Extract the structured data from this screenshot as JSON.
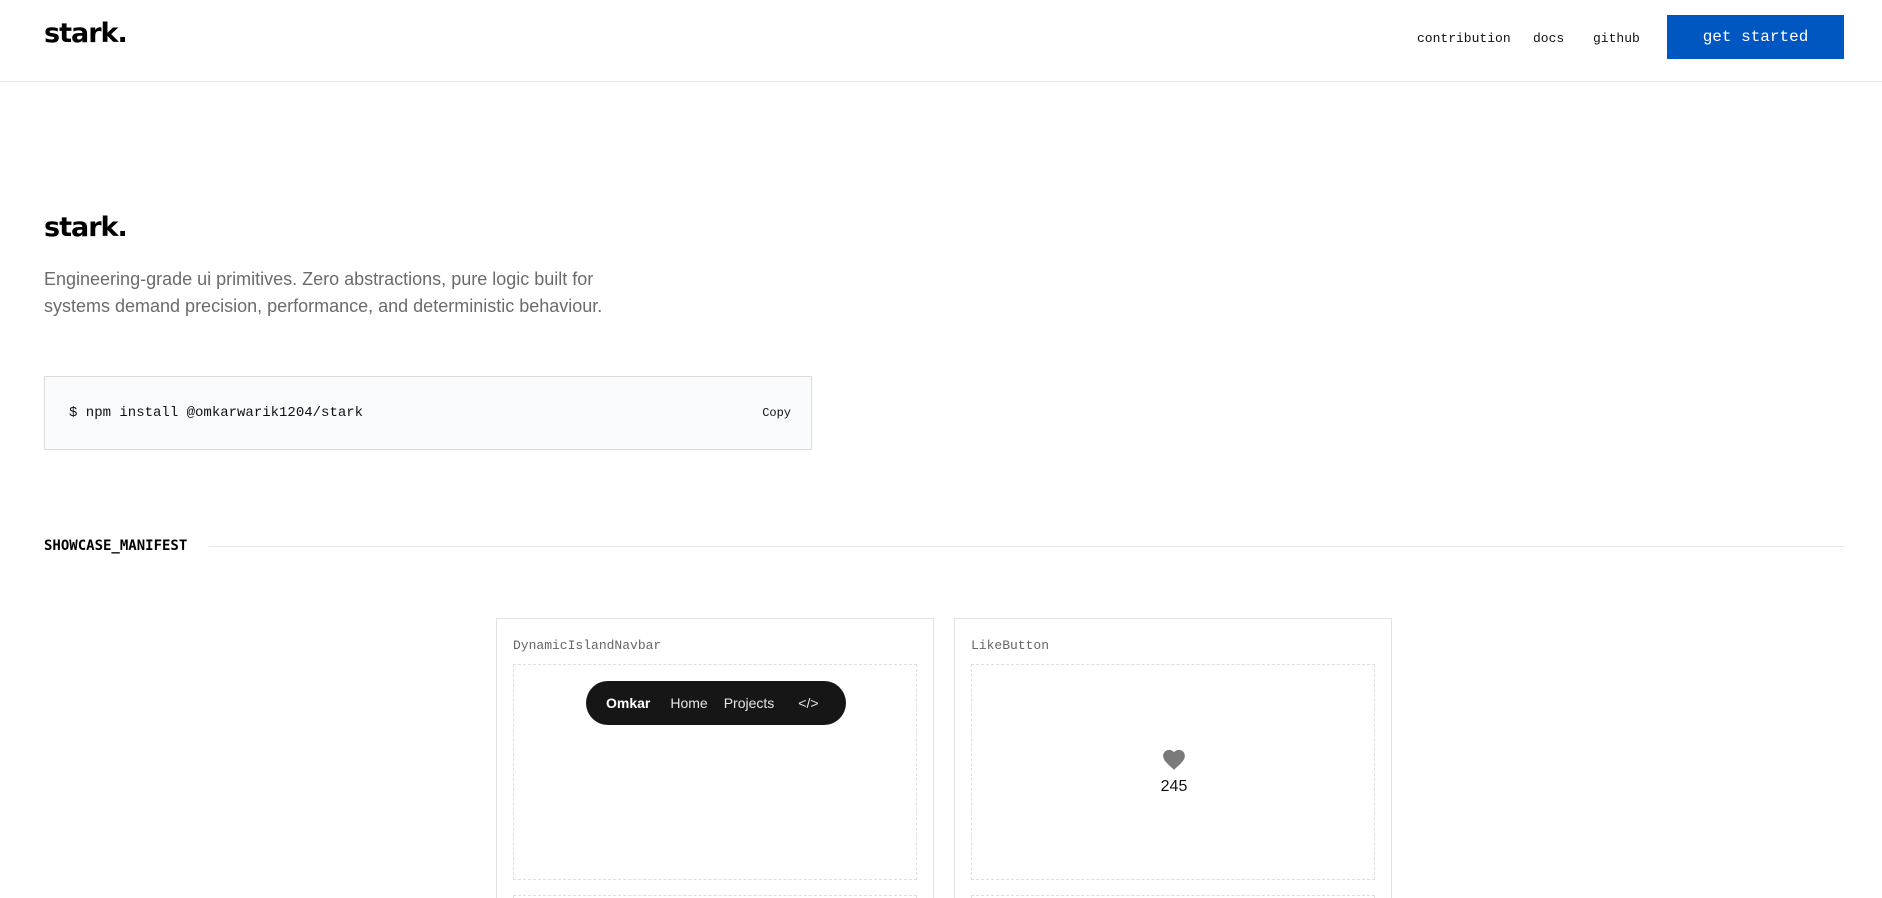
{
  "header": {
    "logo": "stark.",
    "nav": {
      "contribution": "contribution",
      "docs": "docs",
      "github": "github"
    },
    "cta_label": "get started",
    "accent_color": "#0057c2"
  },
  "hero": {
    "title": "stark.",
    "description": "Engineering-grade ui primitives. Zero abstractions, pure logic built for systems demand precision, performance, and deterministic behaviour."
  },
  "install": {
    "command": "$ npm install @omkarwarik1204/stark",
    "copy_label": "Copy"
  },
  "showcase": {
    "label": "SHOWCASE_MANIFEST",
    "cards": [
      {
        "title": "DynamicIslandNavbar",
        "navbar": {
          "brand": "Omkar",
          "items": [
            "Home",
            "Projects",
            "</>"
          ]
        }
      },
      {
        "title": "LikeButton",
        "icon": "heart-icon",
        "count": "245"
      }
    ]
  }
}
